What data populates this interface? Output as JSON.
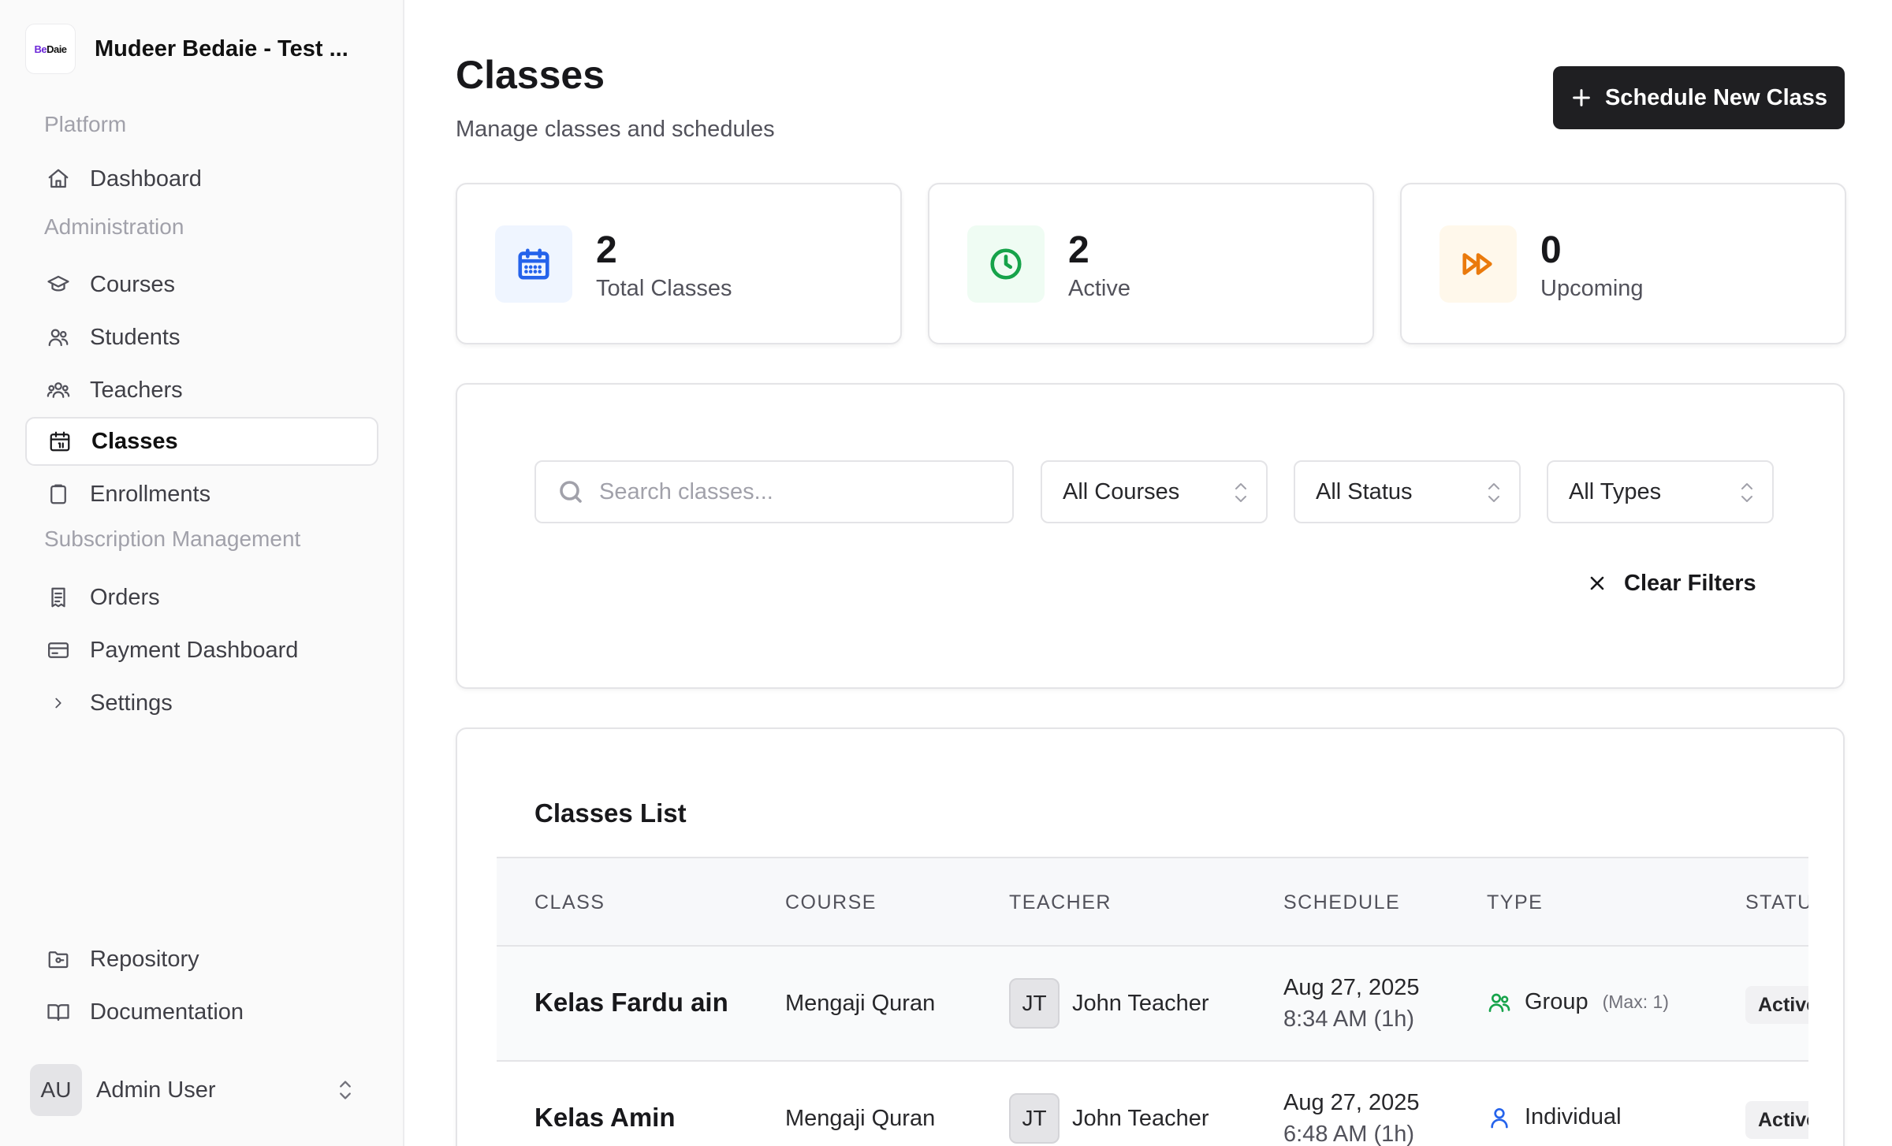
{
  "brand": {
    "logo_text_a": "Be",
    "logo_text_b": "Daie",
    "name": "Mudeer Bedaie - Test ..."
  },
  "sidebar": {
    "section_platform": "Platform",
    "section_admin": "Administration",
    "section_subscription": "Subscription Management",
    "items": {
      "dashboard": "Dashboard",
      "courses": "Courses",
      "students": "Students",
      "teachers": "Teachers",
      "classes": "Classes",
      "enrollments": "Enrollments",
      "orders": "Orders",
      "payment_dashboard": "Payment Dashboard",
      "settings": "Settings",
      "repository": "Repository",
      "documentation": "Documentation"
    },
    "active_item": "Classes",
    "user": {
      "initials": "AU",
      "name": "Admin User"
    }
  },
  "header": {
    "title": "Classes",
    "subtitle": "Manage classes and schedules",
    "primary_button": "Schedule New Class"
  },
  "stats": [
    {
      "value": "2",
      "label": "Total Classes",
      "icon": "calendar-icon",
      "color": "#2563eb",
      "bg": "#eff5ff"
    },
    {
      "value": "2",
      "label": "Active",
      "icon": "clock-icon",
      "color": "#16a34a",
      "bg": "#effcf3"
    },
    {
      "value": "0",
      "label": "Upcoming",
      "icon": "fast-forward-icon",
      "color": "#ea7a0c",
      "bg": "#fff8eb"
    }
  ],
  "filters": {
    "search_placeholder": "Search classes...",
    "course_select": "All Courses",
    "status_select": "All Status",
    "type_select": "All Types",
    "clear_label": "Clear Filters"
  },
  "classes_list": {
    "title": "Classes List",
    "columns": [
      "CLASS",
      "COURSE",
      "TEACHER",
      "SCHEDULE",
      "TYPE",
      "STATUS"
    ],
    "rows": [
      {
        "class": "Kelas Fardu ain",
        "course": "Mengaji Quran",
        "teacher_initials": "JT",
        "teacher": "John Teacher",
        "date": "Aug 27, 2025",
        "time": "8:34 AM (1h)",
        "type": "Group",
        "type_icon": "users-icon",
        "type_color": "#16a34a",
        "max": "(Max: 1)",
        "status": "Active"
      },
      {
        "class": "Kelas Amin",
        "course": "Mengaji Quran",
        "teacher_initials": "JT",
        "teacher": "John Teacher",
        "date": "Aug 27, 2025",
        "time": "6:48 AM (1h)",
        "type": "Individual",
        "type_icon": "user-icon",
        "type_color": "#2563eb",
        "max": "",
        "status": "Active"
      }
    ]
  }
}
